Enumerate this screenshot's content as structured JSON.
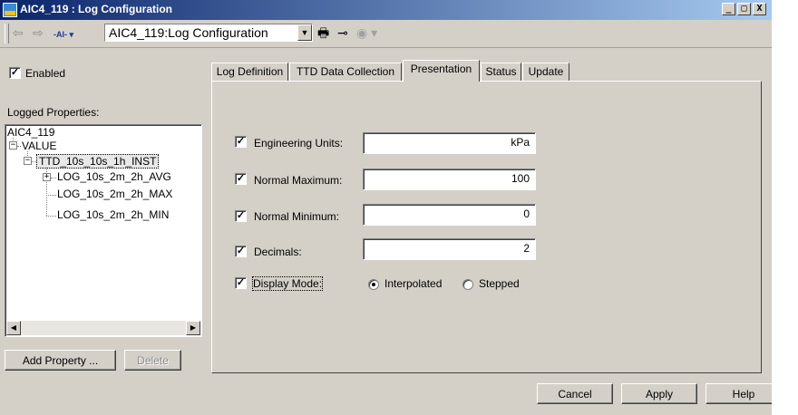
{
  "window": {
    "title": "AIC4_119 : Log Configuration",
    "controls": [
      "_",
      "□",
      "X"
    ]
  },
  "toolbar": {
    "icons": [
      "back-arrow-icon",
      "forward-arrow-icon",
      "attribute-dropdown-icon",
      "print-preview-icon",
      "pin-icon",
      "disabled-tool-icon"
    ],
    "combo_value": "AIC4_119:Log Configuration"
  },
  "left": {
    "enabled_label": "Enabled",
    "enabled_checked": true,
    "logged_properties_label": "Logged Properties:",
    "tree": [
      "AIC4_119",
      "VALUE",
      "TTD_10s_10s_1h_INST",
      "LOG_10s_2m_2h_AVG",
      "LOG_10s_2m_2h_MAX",
      "LOG_10s_2m_2h_MIN"
    ],
    "add_property_label": "Add Property ...",
    "delete_label": "Delete"
  },
  "tabs": [
    {
      "label": "Log Definition",
      "active": false
    },
    {
      "label": "TTD Data Collection",
      "active": false
    },
    {
      "label": "Presentation",
      "active": true
    },
    {
      "label": "Status",
      "active": false
    },
    {
      "label": "Update",
      "active": false
    }
  ],
  "presentation": {
    "engineering_units": {
      "label": "Engineering Units:",
      "checked": true,
      "value": "kPa"
    },
    "normal_maximum": {
      "label": "Normal Maximum:",
      "checked": true,
      "value": "100"
    },
    "normal_minimum": {
      "label": "Normal Minimum:",
      "checked": true,
      "value": "0"
    },
    "decimals": {
      "label": "Decimals:",
      "checked": true,
      "value": "2"
    },
    "display_mode": {
      "label": "Display Mode:",
      "checked": true,
      "options": [
        "Interpolated",
        "Stepped"
      ],
      "selected": "Interpolated"
    }
  },
  "footer": {
    "cancel": "Cancel",
    "apply": "Apply",
    "help": "Help"
  },
  "colors": {
    "face": "#d4d0c8",
    "title_start": "#0a246a",
    "title_end": "#a6caf0"
  }
}
